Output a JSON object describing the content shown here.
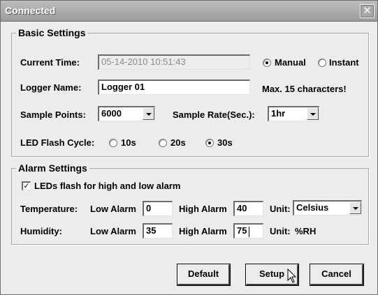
{
  "window": {
    "title": "Connected",
    "close_label": "✕"
  },
  "basic": {
    "legend": "Basic Settings",
    "current_time_label": "Current Time:",
    "current_time_value": "05-14-2010 10:51:43",
    "manual_label": "Manual",
    "instant_label": "Instant",
    "time_mode_selected": "Manual",
    "logger_name_label": "Logger Name:",
    "logger_name_value": "Logger 01",
    "logger_name_hint": "Max. 15 characters!",
    "sample_points_label": "Sample Points:",
    "sample_points_value": "6000",
    "sample_rate_label": "Sample Rate(Sec.):",
    "sample_rate_value": "1hr",
    "led_flash_label": "LED Flash Cycle:",
    "led_options": [
      "10s",
      "20s",
      "30s"
    ],
    "led_selected": "30s"
  },
  "alarm": {
    "legend": "Alarm Settings",
    "led_alarm_label": "LEDs flash for high and low alarm",
    "led_alarm_checked": true,
    "check_mark": "✓",
    "temp_label": "Temperature:",
    "temp_low_label": "Low Alarm",
    "temp_low_value": "0",
    "temp_high_label": "High Alarm",
    "temp_high_value": "40",
    "temp_unit_label": "Unit:",
    "temp_unit_value": "Celsius",
    "hum_label": "Humidity:",
    "hum_low_label": "Low Alarm",
    "hum_low_value": "35",
    "hum_high_label": "High Alarm",
    "hum_high_value": "75",
    "hum_unit_label": "Unit:",
    "hum_unit_value": "%RH"
  },
  "buttons": {
    "default": "Default",
    "setup": "Setup",
    "cancel": "Cancel"
  },
  "colors": {
    "title_bar": "#a8a8a8",
    "dialog_bg": "#ececec"
  },
  "icons": {
    "mouse_pointer": "arrow-cursor-icon"
  }
}
